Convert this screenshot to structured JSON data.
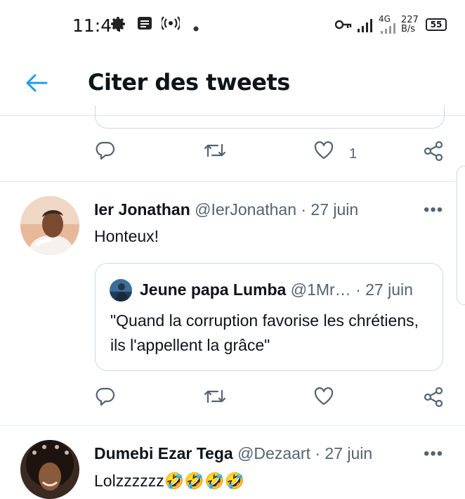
{
  "status_bar": {
    "time": "11:44",
    "network_type": "4G",
    "speed_value": "227",
    "speed_unit": "B/s",
    "battery": "55",
    "icons": [
      "gear-icon",
      "notes-icon",
      "radio-icon",
      "dot-icon",
      "key-icon",
      "signal-icon",
      "signal-icon-2"
    ]
  },
  "header": {
    "back_icon": "arrow-left-icon",
    "title": "Citer des tweets"
  },
  "tweets": [
    {
      "actions": {
        "reply_icon": "reply-icon",
        "retweet_icon": "retweet-icon",
        "like_icon": "heart-icon",
        "like_count": "1",
        "share_icon": "share-icon"
      }
    },
    {
      "name": "Ier Jonathan",
      "handle": "@IerJonathan",
      "date": "· 27 juin",
      "more": "•••",
      "text": "Honteux!",
      "quote": {
        "name": "Jeune papa Lumba",
        "handle": "@1Mr…",
        "date": "· 27 juin",
        "text": "\"Quand la corruption favorise les chrétiens, ils l'appellent la grâce\""
      },
      "actions": {
        "reply_icon": "reply-icon",
        "retweet_icon": "retweet-icon",
        "like_icon": "heart-icon",
        "share_icon": "share-icon"
      }
    },
    {
      "name": "Dumebi Ezar Tega",
      "handle": "@Dezaart",
      "date": "· 27 juin",
      "more": "•••",
      "text": "Lolzzzzzz🤣🤣🤣🤣"
    }
  ],
  "colors": {
    "accent": "#1d9bf0",
    "muted": "#536471",
    "border": "#cfd9de"
  }
}
